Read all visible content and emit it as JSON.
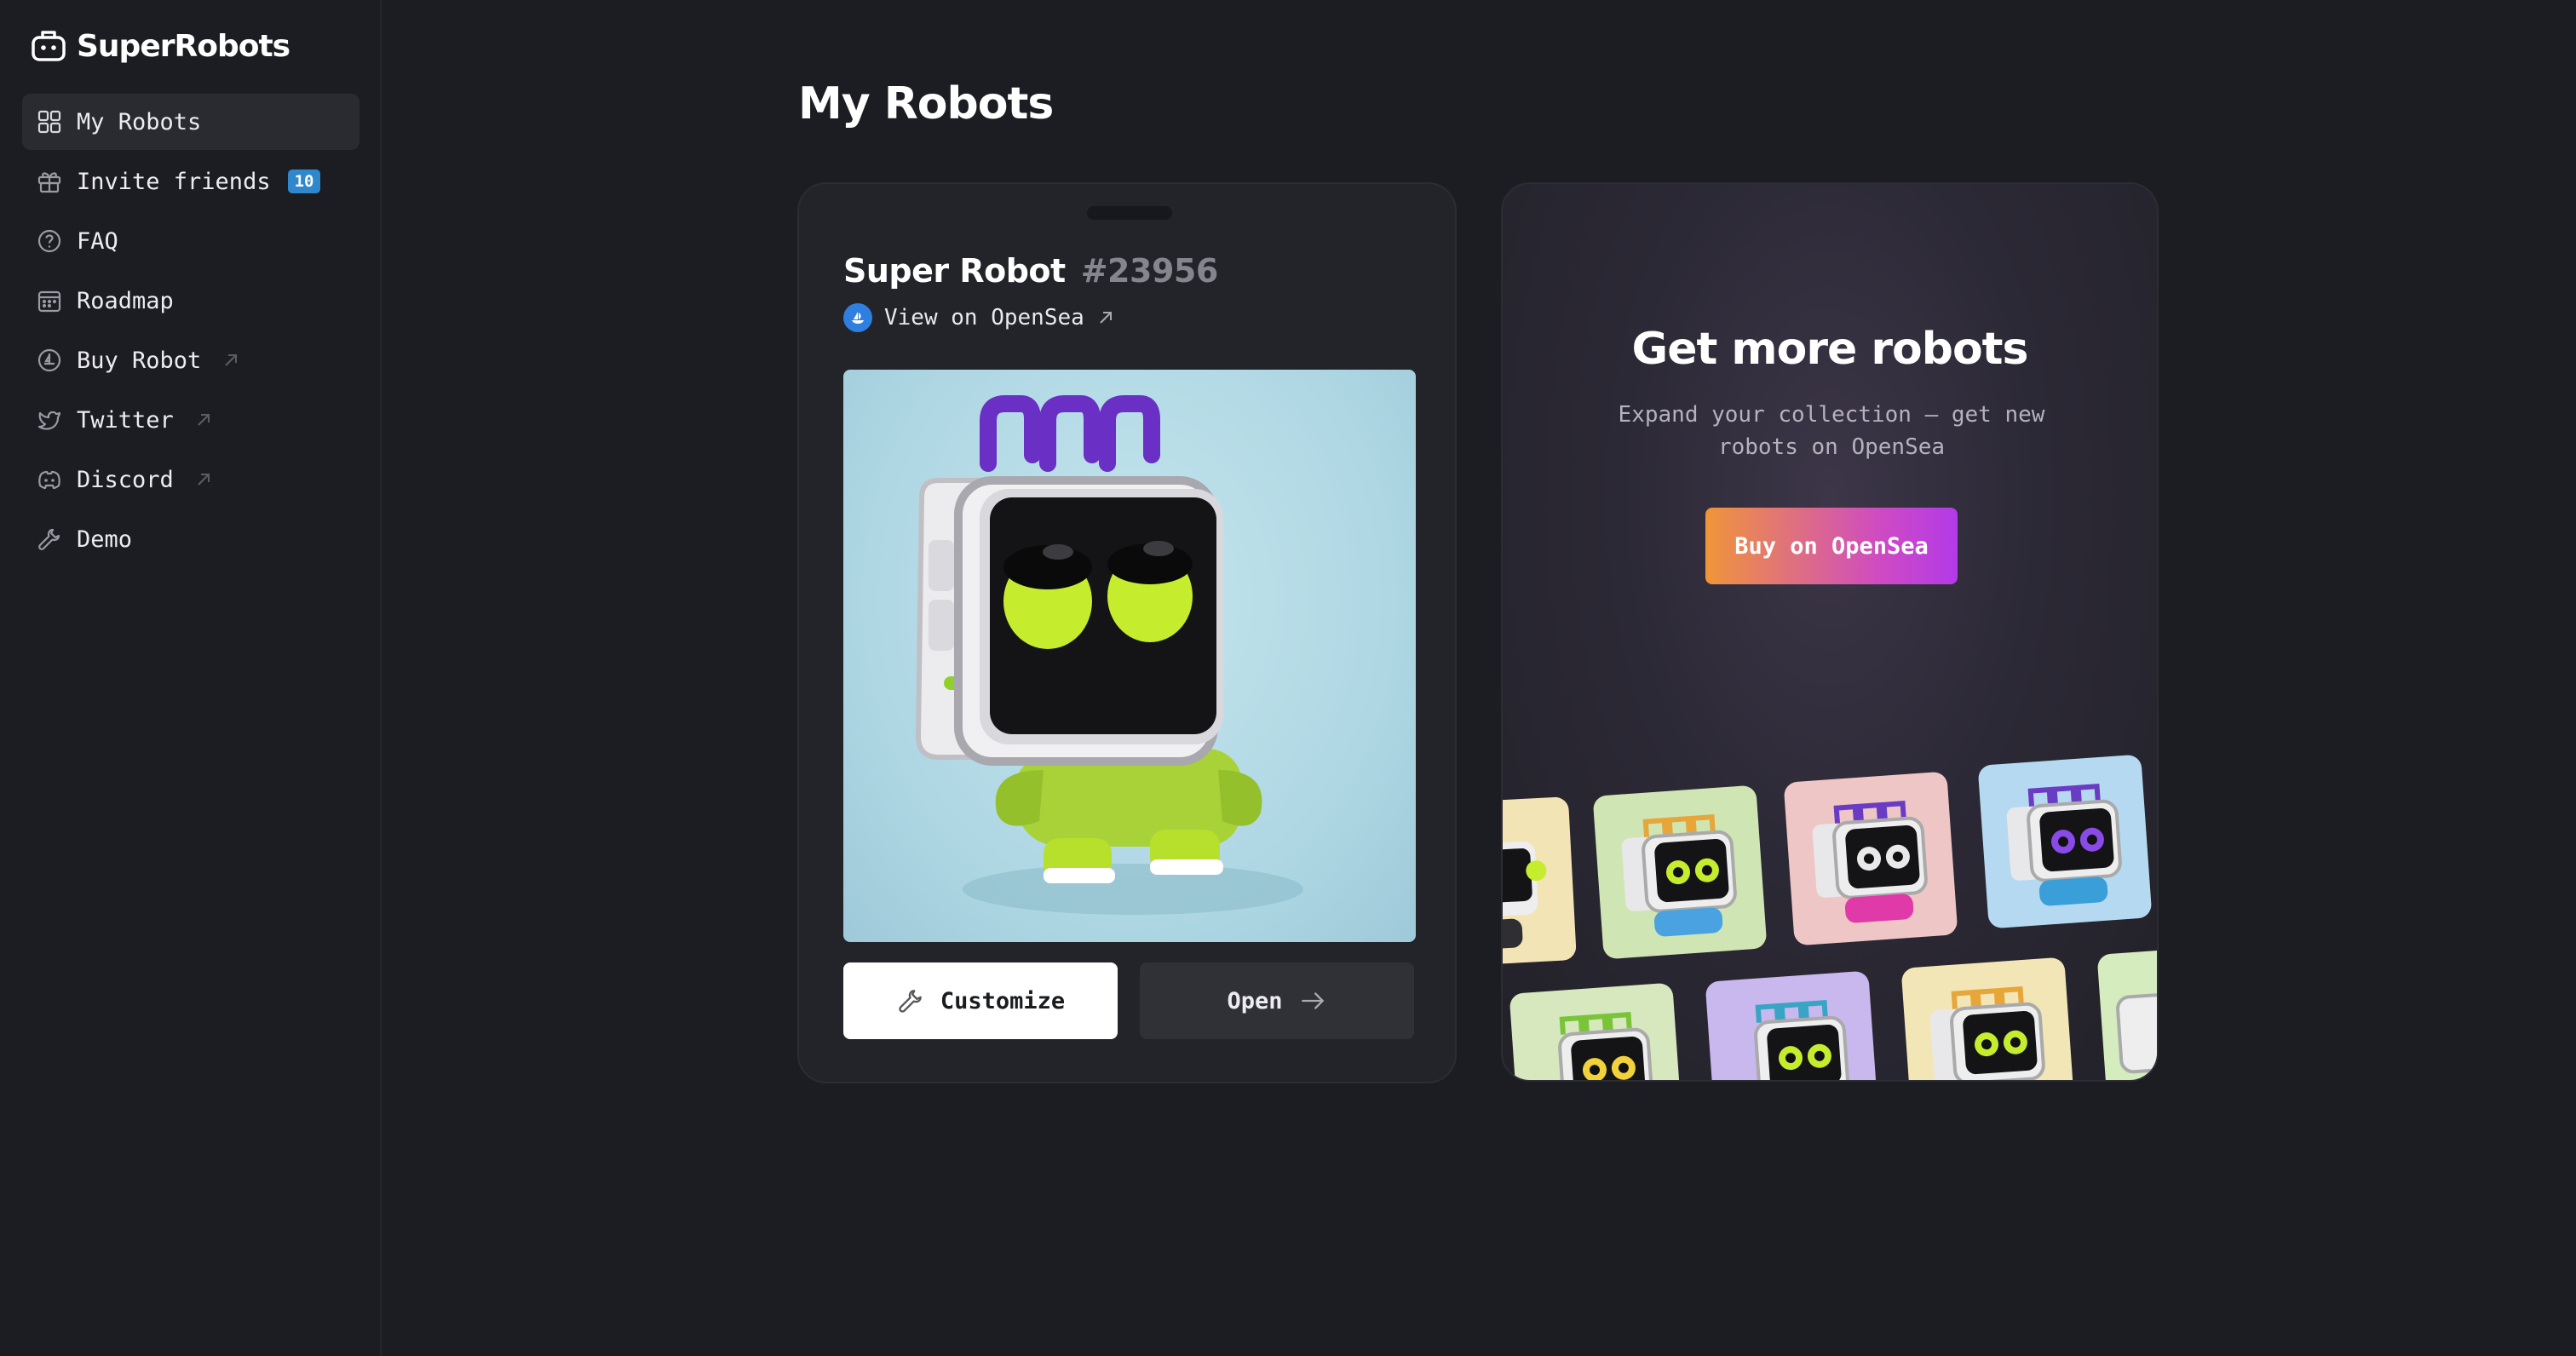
{
  "app": {
    "name": "SuperRobots"
  },
  "sidebar": {
    "items": [
      {
        "label": "My Robots",
        "icon": "grid-icon",
        "active": true
      },
      {
        "label": "Invite friends",
        "icon": "gift-icon",
        "badge": "10"
      },
      {
        "label": "FAQ",
        "icon": "question-circle-icon"
      },
      {
        "label": "Roadmap",
        "icon": "calendar-icon"
      },
      {
        "label": "Buy Robot",
        "icon": "opensea-icon",
        "external": true
      },
      {
        "label": "Twitter",
        "icon": "twitter-icon",
        "external": true
      },
      {
        "label": "Discord",
        "icon": "discord-icon",
        "external": true
      },
      {
        "label": "Demo",
        "icon": "wrench-icon"
      }
    ]
  },
  "main": {
    "title": "My Robots",
    "robot_card": {
      "name": "Super Robot",
      "number": "#23956",
      "link_label": "View on OpenSea",
      "customize_label": "Customize",
      "open_label": "Open"
    },
    "promo_card": {
      "title": "Get more robots",
      "subtitle": "Expand your collection — get new robots on OpenSea",
      "button_label": "Buy on OpenSea"
    }
  },
  "colors": {
    "background": "#1c1d22",
    "card": "#232429",
    "badge": "#2f88cc",
    "promo_gradient_start": "#f0953a",
    "promo_gradient_end": "#b23ae8"
  }
}
